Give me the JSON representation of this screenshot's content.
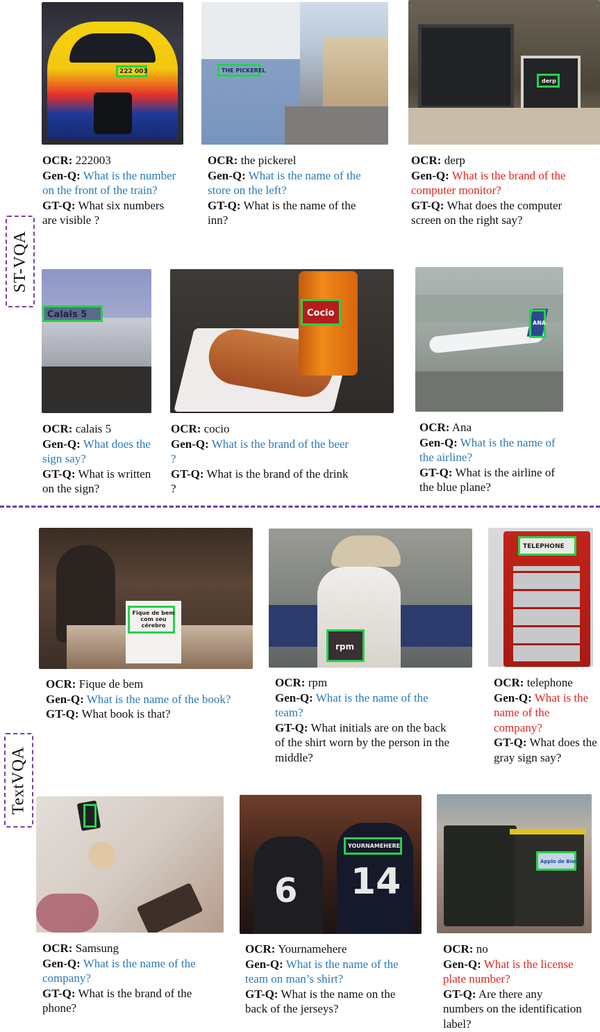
{
  "labels": {
    "stvqa": "ST-VQA",
    "textvqa": "TextVQA"
  },
  "field_labels": {
    "ocr": "OCR:",
    "gen": "Gen-Q:",
    "gt": "GT-Q:"
  },
  "colors": {
    "correct_question": "#2a7ab8",
    "incorrect_question": "#e3261f",
    "bbox": "#23d34a",
    "divider": "#6b3f9e"
  },
  "stvqa": [
    {
      "ocr": "222003",
      "gen_q": "What is the number on the front of the train?",
      "gen_q_color": "blue",
      "gt_q": "What six numbers are visible ?",
      "box_text": "222 003"
    },
    {
      "ocr": "the pickerel",
      "gen_q": "What is the name of the store on the left?",
      "gen_q_color": "blue",
      "gt_q": "What is the name of the inn?",
      "box_text": "THE PICKEREL"
    },
    {
      "ocr": "derp",
      "gen_q": "What is the brand of the computer monitor?",
      "gen_q_color": "red",
      "gt_q": "What does the computer screen on the right say?",
      "box_text": "derp"
    },
    {
      "ocr": "calais 5",
      "gen_q": "What does the sign say?",
      "gen_q_color": "blue",
      "gt_q": "What is written on the sign?",
      "box_text": "Calais 5"
    },
    {
      "ocr": "cocio",
      "gen_q": "What is the brand of the beer ?",
      "gen_q_color": "blue",
      "gt_q": "What is the brand of the drink ?",
      "box_text": "Cocio"
    },
    {
      "ocr": "Ana",
      "gen_q": "What is the name of the airline?",
      "gen_q_color": "blue",
      "gt_q": "What is the airline of the blue plane?",
      "box_text": "ANA"
    }
  ],
  "textvqa": [
    {
      "ocr": "Fique de bem",
      "gen_q": "What is the name of the book?",
      "gen_q_color": "blue",
      "gt_q": "What book is that?",
      "box_text": "Fique de bem com seu cérebro"
    },
    {
      "ocr": "rpm",
      "gen_q": "What is the name of the team?",
      "gen_q_color": "blue",
      "gt_q": "What initials are on the back of the shirt worn by the person in the middle?",
      "box_text": "rpm"
    },
    {
      "ocr": "telephone",
      "gen_q": "What is the name of the company?",
      "gen_q_color": "red",
      "gt_q": "What does the gray sign say?",
      "box_text": "TELEPHONE"
    },
    {
      "ocr": "Samsung",
      "gen_q": "What is the name of the company?",
      "gen_q_color": "blue",
      "gt_q": "What is the brand of the phone?",
      "box_text": ""
    },
    {
      "ocr": "Yournamehere",
      "gen_q": "What is the name of the team on man’s shirt?",
      "gen_q_color": "blue",
      "gt_q": "What is the name on the back of the jerseys?",
      "box_text": "YOURNAMEHERE"
    },
    {
      "ocr": "no",
      "gen_q": "What is the license plate number?",
      "gen_q_color": "red",
      "gt_q": "Are there any numbers on the identification label?",
      "box_text": "Applo de Bien"
    }
  ]
}
